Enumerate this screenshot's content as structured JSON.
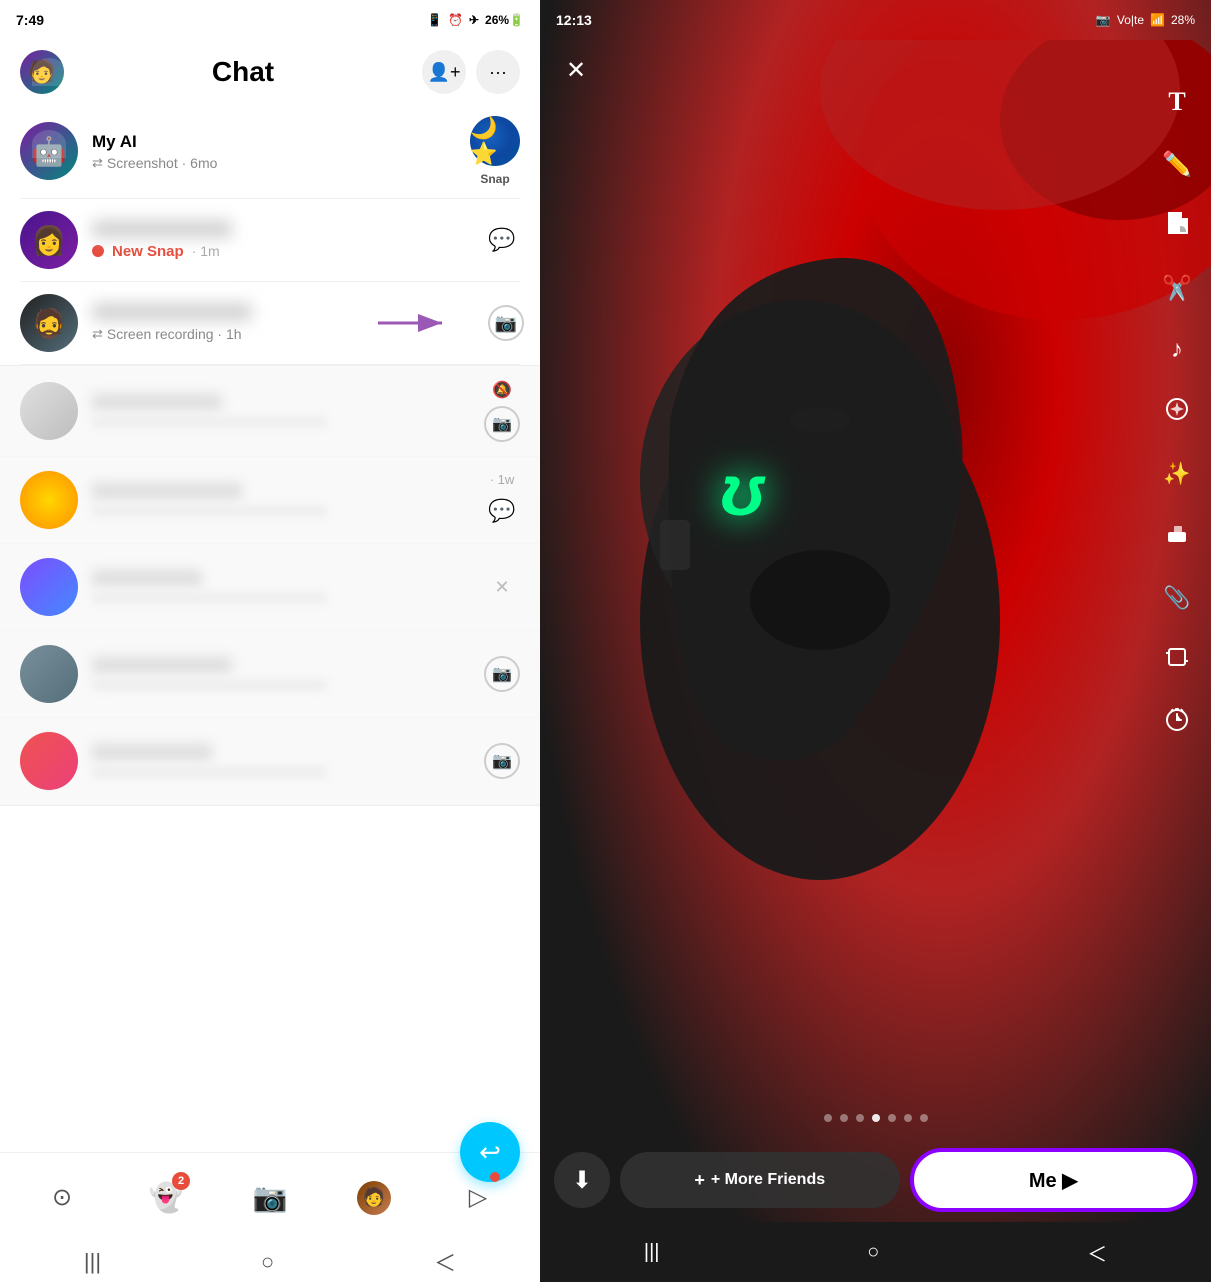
{
  "left": {
    "statusBar": {
      "time": "7:49",
      "icons": "📱 ⏰ ✈ 26%🔋"
    },
    "header": {
      "title": "Chat",
      "addFriendBtn": "+👤",
      "moreBtn": "···"
    },
    "chatItems": [
      {
        "id": "myai",
        "name": "My AI",
        "sub": "Screenshot · 6mo",
        "badge": "🌙",
        "badgeLabel": "Snap",
        "hasSnap": true
      },
      {
        "id": "girl",
        "name": "",
        "sub": "New Snap · 1m",
        "isNewSnap": true,
        "hasMessageIcon": true
      },
      {
        "id": "guy",
        "name": "",
        "sub": "Screen recording · 1h",
        "hasCameraIcon": true,
        "hasArrow": true
      }
    ],
    "blurredItems": [
      {
        "id": "b1",
        "hasMute": true,
        "hasCameraIcon": true
      },
      {
        "id": "b2",
        "hasMute": false,
        "hasMessageIcon": true,
        "time": "1w"
      },
      {
        "id": "b3",
        "hasX": true
      },
      {
        "id": "b4",
        "hasCameraIcon": true
      },
      {
        "id": "b5",
        "hasCameraIcon": true
      }
    ],
    "fab": "↩",
    "bottomNav": [
      {
        "id": "map",
        "icon": "⊙",
        "label": ""
      },
      {
        "id": "stories",
        "icon": "👻",
        "label": "",
        "badge": "2"
      },
      {
        "id": "camera",
        "icon": "⊡",
        "label": ""
      },
      {
        "id": "profile",
        "icon": "👤",
        "label": ""
      },
      {
        "id": "spotlight",
        "icon": "▷",
        "label": "",
        "hasDot": true
      }
    ],
    "sysNav": [
      "|||",
      "○",
      "<"
    ]
  },
  "right": {
    "statusBar": {
      "time": "12:13",
      "battery": "28%"
    },
    "tools": [
      {
        "id": "text",
        "icon": "T",
        "label": "text-tool"
      },
      {
        "id": "pencil",
        "icon": "✏",
        "label": "pencil-tool"
      },
      {
        "id": "sticker",
        "icon": "🗂",
        "label": "sticker-tool"
      },
      {
        "id": "scissors",
        "icon": "✂",
        "label": "scissors-tool"
      },
      {
        "id": "music",
        "icon": "♪",
        "label": "music-tool"
      },
      {
        "id": "lens",
        "icon": "⊛",
        "label": "lens-tool"
      },
      {
        "id": "magic",
        "icon": "✨",
        "label": "magic-tool"
      },
      {
        "id": "eraser",
        "icon": "◈",
        "label": "eraser-tool"
      },
      {
        "id": "link",
        "icon": "🔗",
        "label": "link-tool"
      },
      {
        "id": "crop",
        "icon": "⊞",
        "label": "crop-tool"
      },
      {
        "id": "timer",
        "icon": "⊛",
        "label": "timer-tool"
      }
    ],
    "dots": [
      false,
      false,
      false,
      true,
      false,
      false,
      false
    ],
    "bottomBar": {
      "downloadLabel": "⬇",
      "friendsLabel": "+ More Friends",
      "meLabel": "Me ▶"
    },
    "sysNav": [
      "|||",
      "○",
      "<"
    ]
  }
}
